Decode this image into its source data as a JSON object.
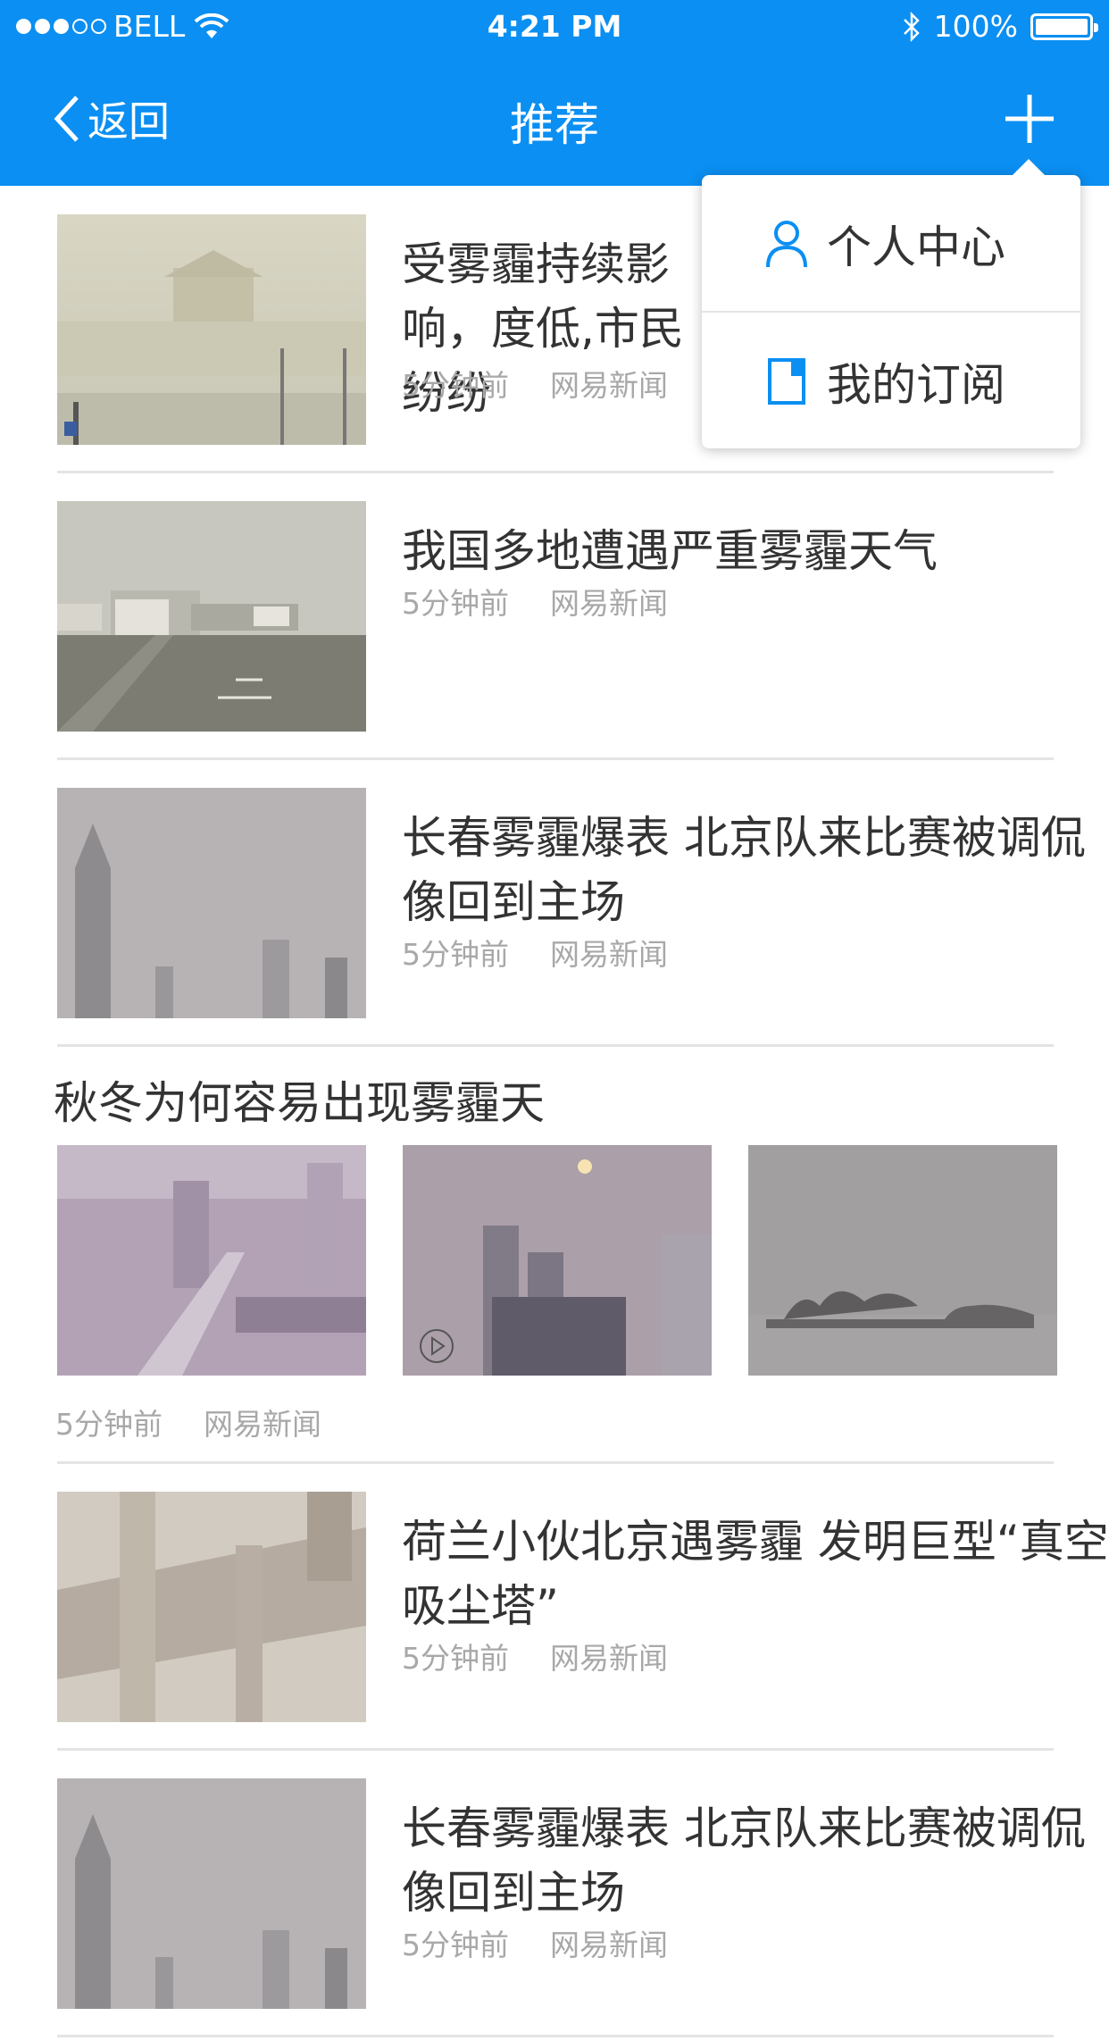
{
  "status_bar": {
    "carrier": "BELL",
    "time": "4:21 PM",
    "battery": "100%"
  },
  "nav": {
    "back_label": "返回",
    "title": "推荐"
  },
  "menu": {
    "items": [
      {
        "label": "个人中心"
      },
      {
        "label": "我的订阅"
      }
    ]
  },
  "articles": [
    {
      "title": "受雾霾持续影响，度低,市民纷纷",
      "time": "5分钟前",
      "source": "网易新闻"
    },
    {
      "title": "我国多地遭遇严重雾霾天气",
      "time": "5分钟前",
      "source": "网易新闻"
    },
    {
      "title": "长春雾霾爆表  北京队来比赛被调侃像回到主场",
      "time": "5分钟前",
      "source": "网易新闻"
    },
    {
      "title": "荷兰小伙北京遇雾霾 发明巨型“真空吸尘塔”",
      "time": "5分钟前",
      "source": "网易新闻"
    },
    {
      "title": "长春雾霾爆表  北京队来比赛被调侃像回到主场",
      "time": "5分钟前",
      "source": "网易新闻"
    }
  ],
  "gallery": {
    "title": "秋冬为何容易出现雾霾天",
    "time": "5分钟前",
    "source": "网易新闻"
  },
  "colors": {
    "brand_blue": "#0b8ff2",
    "meta_gray": "#a8a8a8",
    "divider": "#e4e4e4"
  }
}
